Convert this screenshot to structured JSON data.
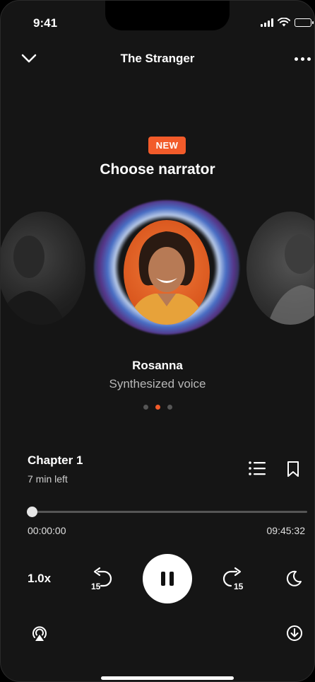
{
  "status_bar": {
    "time": "9:41"
  },
  "header": {
    "title": "The Stranger"
  },
  "narrator_picker": {
    "badge": "NEW",
    "heading": "Choose narrator",
    "selected": {
      "name": "Rosanna",
      "subtitle": "Synthesized voice"
    },
    "page_index": 2,
    "page_count": 3
  },
  "chapter": {
    "title": "Chapter 1",
    "remaining": "7 min left"
  },
  "progress": {
    "elapsed": "00:00:00",
    "total": "09:45:32",
    "fraction": 0.0
  },
  "controls": {
    "speed": "1.0x",
    "skip_back": "15",
    "skip_forward": "15"
  },
  "colors": {
    "accent": "#f25b2a",
    "background": "#151515"
  },
  "icons": [
    "chevron-down-icon",
    "more-icon",
    "chapters-list-icon",
    "bookmark-icon",
    "skip-back-icon",
    "pause-icon",
    "skip-forward-icon",
    "sleep-timer-moon-icon",
    "airplay-icon",
    "download-icon"
  ]
}
